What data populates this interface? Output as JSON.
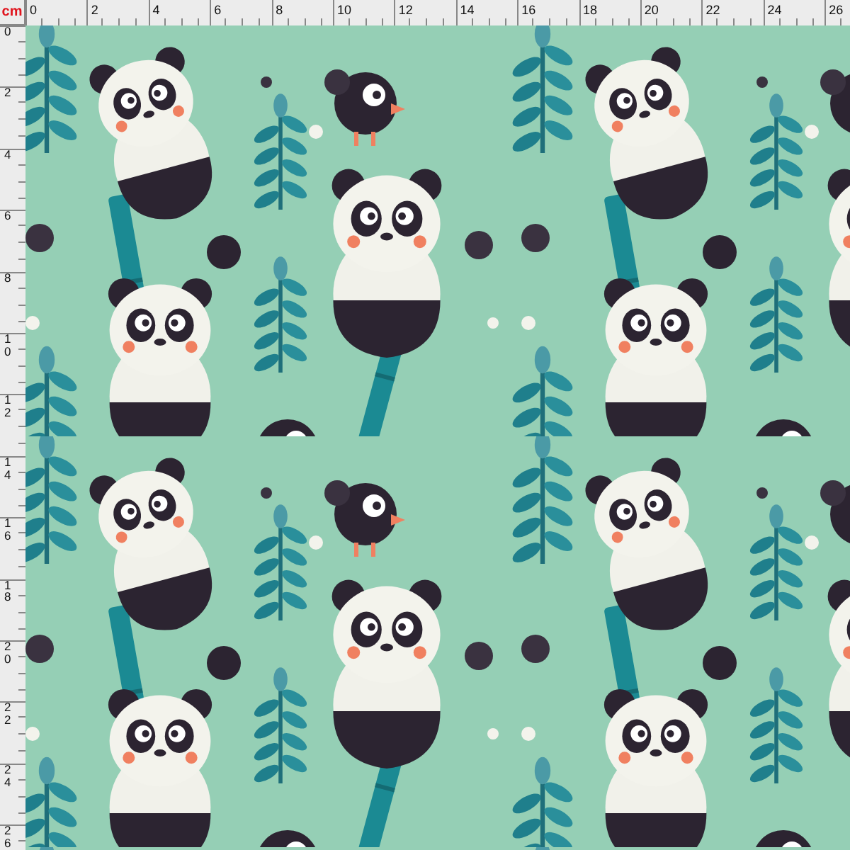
{
  "ruler": {
    "unit": "cm",
    "top_labels": [
      "0",
      "2",
      "4",
      "6",
      "8",
      "10",
      "12",
      "14",
      "16",
      "18",
      "20",
      "22",
      "24",
      "26"
    ],
    "left_labels": [
      "0",
      "2",
      "4",
      "6",
      "8",
      "10",
      "12",
      "14",
      "16",
      "18",
      "20",
      "22",
      "24",
      "26"
    ]
  }
}
